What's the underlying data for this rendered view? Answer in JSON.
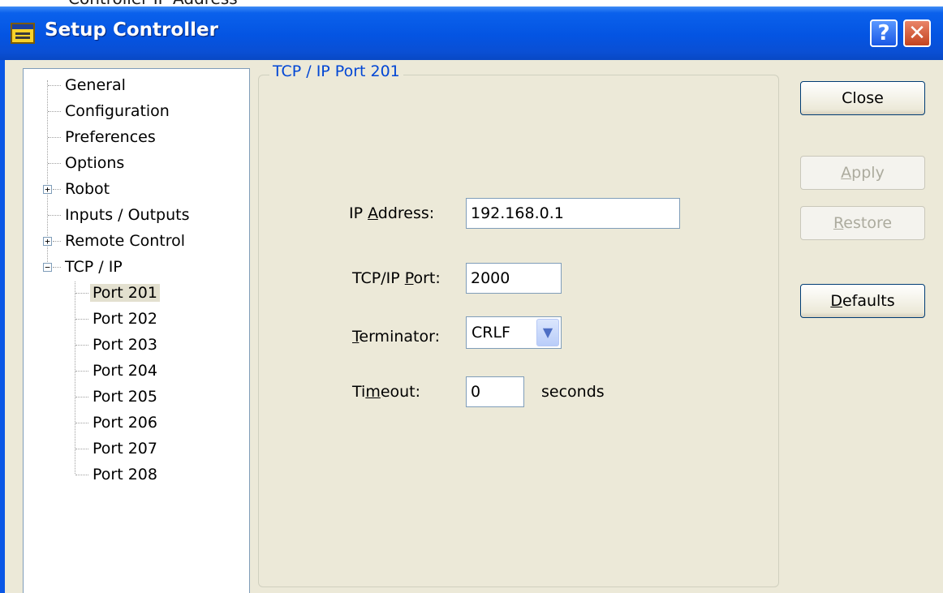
{
  "background_caption": "Controller IP Address",
  "window": {
    "title": "Setup Controller",
    "help_glyph": "?",
    "close_glyph": "✕"
  },
  "tree": {
    "general": "General",
    "configuration": "Configuration",
    "preferences": "Preferences",
    "options": "Options",
    "robot": "Robot",
    "inputs_outputs": "Inputs / Outputs",
    "remote_control": "Remote Control",
    "tcp_ip": "TCP / IP",
    "ports": [
      "Port 201",
      "Port 202",
      "Port 203",
      "Port 204",
      "Port 205",
      "Port 206",
      "Port 207",
      "Port 208"
    ],
    "selected": "Port 201",
    "expander_plus": "+",
    "expander_minus": "−"
  },
  "panel": {
    "group_title": "TCP / IP Port 201",
    "ip_label_pre": "IP ",
    "ip_label_ul": "A",
    "ip_label_post": "ddress:",
    "ip_value": "192.168.0.1",
    "port_label_pre": "TCP/IP ",
    "port_label_ul": "P",
    "port_label_post": "ort:",
    "port_value": "2000",
    "term_label_ul": "T",
    "term_label_post": "erminator:",
    "term_value": "CRLF",
    "timeout_label_pre": "Ti",
    "timeout_label_ul": "m",
    "timeout_label_post": "eout:",
    "timeout_value": "0",
    "timeout_unit": "seconds"
  },
  "buttons": {
    "close": "Close",
    "apply_ul": "A",
    "apply_rest": "pply",
    "restore_ul": "R",
    "restore_rest": "estore",
    "defaults_ul": "D",
    "defaults_rest": "efaults"
  }
}
